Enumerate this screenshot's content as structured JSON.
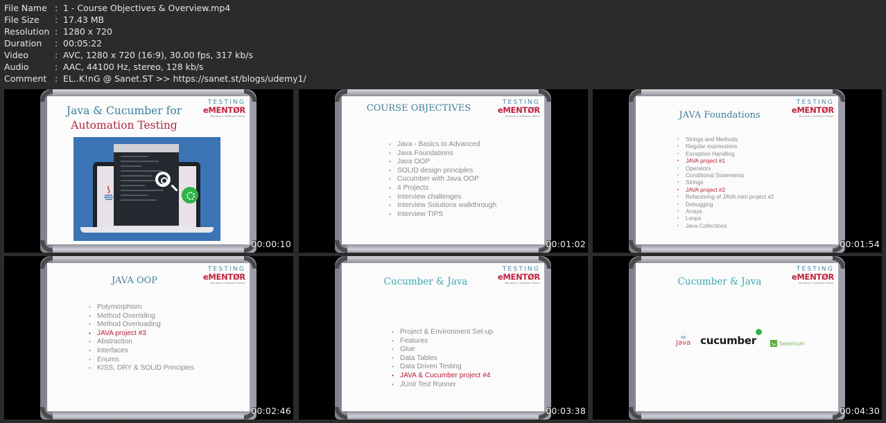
{
  "file_info": {
    "rows": [
      {
        "key": "File Name",
        "value": "1 - Course Objectives & Overview.mp4"
      },
      {
        "key": "File Size",
        "value": "17.43 MB"
      },
      {
        "key": "Resolution",
        "value": "1280 x 720"
      },
      {
        "key": "Duration",
        "value": "00:05:22"
      },
      {
        "key": "Video",
        "value": "AVC, 1280 x 720 (16:9), 30.00 fps, 317 kb/s"
      },
      {
        "key": "Audio",
        "value": "AAC, 44100 Hz, stereo, 128 kb/s"
      },
      {
        "key": "Comment",
        "value": "EL..K!nG @ Sanet.ST >> https://sanet.st/blogs/udemy1/"
      }
    ],
    "separator": ":"
  },
  "logo": {
    "line1": "TESTING",
    "line2": "eMENTØR",
    "tagline": "Become a Software Tester"
  },
  "thumbnails": [
    {
      "timestamp": "00:00:10",
      "title_line1": "Java & Cucumber for",
      "title_line2": "Automation Testing"
    },
    {
      "timestamp": "00:01:02",
      "title": "COURSE OBJECTIVES",
      "bullets": [
        {
          "text": "Java - Basics to Advanced",
          "highlight": false
        },
        {
          "text": "Java Foundations",
          "highlight": false
        },
        {
          "text": "Java OOP",
          "highlight": false
        },
        {
          "text": "SOLID design principles",
          "highlight": false
        },
        {
          "text": "Cucumber with Java OOP",
          "highlight": false
        },
        {
          "text": "4 Projects",
          "highlight": false
        },
        {
          "text": "Interview challenges",
          "highlight": false
        },
        {
          "text": "Interview Solutions walkthrough",
          "highlight": false
        },
        {
          "text": "Interview TIPS",
          "highlight": false
        }
      ]
    },
    {
      "timestamp": "00:01:54",
      "title": "JAVA Foundations",
      "bullets": [
        {
          "text": "Strings and Methods",
          "highlight": false
        },
        {
          "text": "Regular expressions",
          "highlight": false
        },
        {
          "text": "Exception Handling",
          "highlight": false
        },
        {
          "text": "JAVA project #1",
          "highlight": true
        },
        {
          "text": "Operators",
          "highlight": false
        },
        {
          "text": "Conditional Statements",
          "highlight": false
        },
        {
          "text": "Strings",
          "highlight": false
        },
        {
          "text": "JAVA project #2",
          "highlight": true
        },
        {
          "text": "Refactoring of JAVA mini project #2",
          "highlight": false
        },
        {
          "text": "Debugging",
          "highlight": false
        },
        {
          "text": "Arrays",
          "highlight": false
        },
        {
          "text": "Loops",
          "highlight": false
        },
        {
          "text": "Java Collections",
          "highlight": false
        }
      ]
    },
    {
      "timestamp": "00:02:46",
      "title": "JAVA OOP",
      "bullets": [
        {
          "text": "Polymorphism",
          "highlight": false
        },
        {
          "text": "Method Overriding",
          "highlight": false
        },
        {
          "text": "Method Overloading",
          "highlight": false
        },
        {
          "text": "JAVA project #3",
          "highlight": true
        },
        {
          "text": "Abstraction",
          "highlight": false
        },
        {
          "text": "Interfaces",
          "highlight": false
        },
        {
          "text": "Enums",
          "highlight": false
        },
        {
          "text": "KISS, DRY & SOLID Principles",
          "highlight": false
        }
      ]
    },
    {
      "timestamp": "00:03:38",
      "title": "Cucumber & Java",
      "bullets": [
        {
          "text": "Project & Environment Set-up",
          "highlight": false
        },
        {
          "text": "Features",
          "highlight": false
        },
        {
          "text": "Glue",
          "highlight": false
        },
        {
          "text": "Data Tables",
          "highlight": false
        },
        {
          "text": "Data Driven Testing",
          "highlight": false
        },
        {
          "text": "JAVA & Cucumber project #4",
          "highlight": true
        },
        {
          "text": "JUnit Test Runner",
          "highlight": false
        }
      ]
    },
    {
      "timestamp": "00:04:30",
      "title": "Cucumber & Java",
      "logos": {
        "java": "Java",
        "cucumber": "cucumber",
        "selenium": "Selenium",
        "selenium_badge": "Se"
      }
    }
  ],
  "colors": {
    "background": "#2b2b2b",
    "info_text": "#e6e6e6",
    "slide_title": "#3f7f98",
    "slide_title_teal": "#3aa9b3",
    "bullet_text": "#8a8a8a",
    "highlight": "#b51f3c",
    "brand_red": "#c0233f",
    "cucumber_green": "#2fb24a"
  }
}
